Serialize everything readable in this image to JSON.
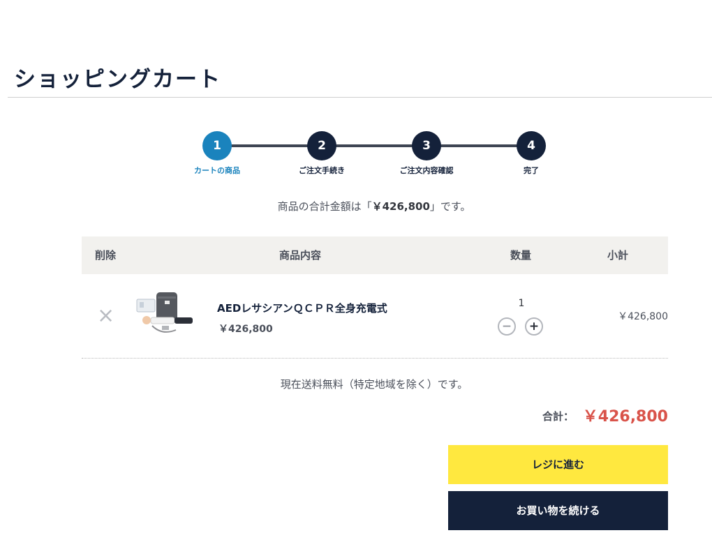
{
  "header": {
    "title": "ショッピングカート"
  },
  "steps": [
    {
      "number": "1",
      "label": "カートの商品",
      "active": true
    },
    {
      "number": "2",
      "label": "ご注文手続き",
      "active": false
    },
    {
      "number": "3",
      "label": "ご注文内容確認",
      "active": false
    },
    {
      "number": "4",
      "label": "完了",
      "active": false
    }
  ],
  "summary": {
    "prefix": "商品の合計金額は「",
    "amount": "￥426,800",
    "suffix": "」です。"
  },
  "table": {
    "headers": {
      "remove": "削除",
      "item": "商品内容",
      "quantity": "数量",
      "subtotal": "小計"
    },
    "rows": [
      {
        "name": "AEDレサシアンＱＣＰＲ全身充電式",
        "price": "￥426,800",
        "quantity": "1",
        "subtotal": "￥426,800"
      }
    ]
  },
  "shipping_note": "現在送料無料（特定地域を除く）です。",
  "total": {
    "label": "合計：",
    "value": "￥426,800"
  },
  "buttons": {
    "checkout": "レジに進む",
    "continue": "お買い物を続ける"
  },
  "colors": {
    "navy": "#14213a",
    "active_step": "#1a83bd",
    "checkout_yellow": "#ffe83f",
    "total_red": "#d9534a"
  }
}
